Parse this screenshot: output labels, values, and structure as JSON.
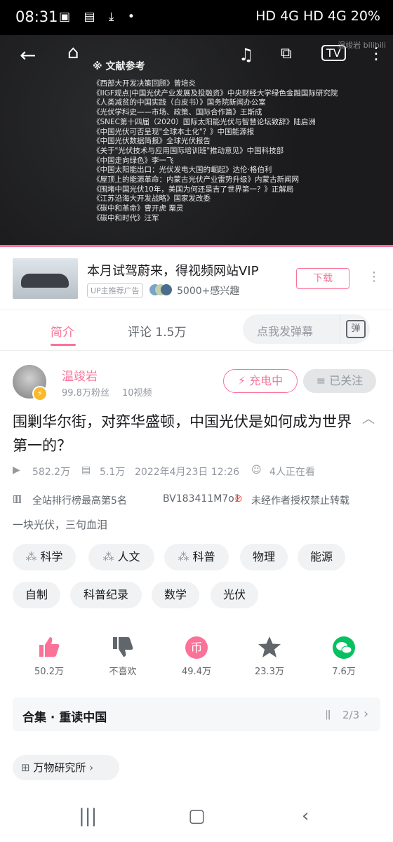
{
  "status_bar": {
    "time": "08:31",
    "right": "HD 4G HD 4G 20%"
  },
  "video": {
    "refs_title": "※ 文献参考",
    "watermark": "温竣岩 bilibili",
    "refs": [
      "《西部大开发决策回顾》曾培炎",
      "《IIGF观点|中国光伏产业发展及投融资》中央财经大学绿色金融国际研究院",
      "《人类减贫的中国实践（白皮书）》国务院新闻办公室",
      "《光伏学科史——市场、政策、国际合作篇》王斯成",
      "《SNEC第十四届（2020）国际太阳能光伏与智慧论坛致辞》陆启洲",
      "《中国光伏可否呈现\"全球本土化\"？》中国能源报",
      "《中国光伏数据简报》全球光伏报告",
      "《关于\"光伏技术与应用国际培训班\"推动意见》中国科技部",
      "《中国走向绿色》李一飞",
      "《中国太阳能出口：光伏发电大国的崛起》达伦·格伯利",
      "《屋顶上的能源革命：内蒙古光伏产业雷势升级》内蒙古新闻网",
      "《围堵中国光伏10年，美国为何还是吉了世界第一？》正解局",
      "《江苏沿海大开发战略》国家发改委",
      "《碳中和革命》曹开虎 粟灵",
      "《碳中和时代》汪军"
    ]
  },
  "ad": {
    "title": "本月试驾蔚来，得视频网站VIP",
    "tag": "UP主推荐广告",
    "interest": "5000+感兴趣",
    "download": "下载"
  },
  "tabs": {
    "intro": "简介",
    "comments": "评论 1.5万",
    "danmaku_placeholder": "点我发弹幕",
    "danmaku_icon": "弹"
  },
  "uploader": {
    "name": "温竣岩",
    "fans": "99.8万粉丝",
    "videos": "10视频",
    "charge": "充电中",
    "follow": "已关注"
  },
  "video_info": {
    "title": "围剿华尔街，对弈华盛顿，中国光伏是如何成为世界第一的？",
    "views": "582.2万",
    "danmaku": "5.1万",
    "date": "2022年4月23日 12:26",
    "watching": "4人正在看",
    "rank": "全站排行榜最高第5名",
    "bvid": "BV183411M7o1",
    "copyright": "未经作者授权禁止转载",
    "desc": "一块光伏，三句血泪"
  },
  "tags": [
    "科学",
    "人文",
    "科普",
    "物理",
    "能源",
    "自制",
    "科普纪录",
    "数学",
    "光伏"
  ],
  "actions": {
    "like": "50.2万",
    "dislike": "不喜欢",
    "coin": "49.4万",
    "fav": "23.3万",
    "share": "7.6万"
  },
  "collection": {
    "title": "合集 · 重读中国",
    "page": "2/3"
  },
  "topic": {
    "label": "万物研究所"
  },
  "colors": {
    "accent": "#fb7299",
    "share": "#07c160"
  }
}
